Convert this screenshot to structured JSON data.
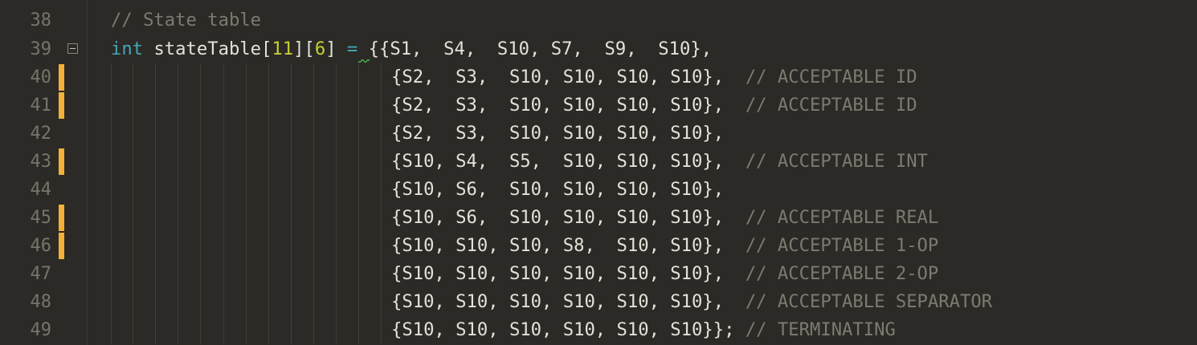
{
  "editor": {
    "lines": [
      {
        "number": "38",
        "code": "// State table",
        "type": "comment",
        "changed": false
      },
      {
        "number": "39",
        "type": "declaration",
        "changed": false,
        "keyword": "int",
        "identifier": "stateTable",
        "dim1_open": "[",
        "dim1": "11",
        "dim_mid": "][",
        "dim2": "6",
        "dim2_close": "]",
        "assign": "=",
        "rest": "{{S1,  S4,  S10, S7,  S9,  S10},"
      },
      {
        "number": "40",
        "code": "{S2,  S3,  S10, S10, S10, S10},  ",
        "comment": "// ACCEPTABLE ID",
        "changed": true
      },
      {
        "number": "41",
        "code": "{S2,  S3,  S10, S10, S10, S10},  ",
        "comment": "// ACCEPTABLE ID",
        "changed": true
      },
      {
        "number": "42",
        "code": "{S2,  S3,  S10, S10, S10, S10},",
        "comment": "",
        "changed": false
      },
      {
        "number": "43",
        "code": "{S10, S4,  S5,  S10, S10, S10},  ",
        "comment": "// ACCEPTABLE INT",
        "changed": true
      },
      {
        "number": "44",
        "code": "{S10, S6,  S10, S10, S10, S10},",
        "comment": "",
        "changed": false
      },
      {
        "number": "45",
        "code": "{S10, S6,  S10, S10, S10, S10},  ",
        "comment": "// ACCEPTABLE REAL",
        "changed": true
      },
      {
        "number": "46",
        "code": "{S10, S10, S10, S8,  S10, S10},  ",
        "comment": "// ACCEPTABLE 1-OP",
        "changed": true
      },
      {
        "number": "47",
        "code": "{S10, S10, S10, S10, S10, S10},  ",
        "comment": "// ACCEPTABLE 2-OP",
        "changed": false
      },
      {
        "number": "48",
        "code": "{S10, S10, S10, S10, S10, S10},  ",
        "comment": "// ACCEPTABLE SEPARATOR",
        "changed": false
      },
      {
        "number": "49",
        "code": "{S10, S10, S10, S10, S10, S10}}; ",
        "comment": "// TERMINATING",
        "changed": false
      }
    ],
    "fold_icon": "fold-collapse-icon",
    "colors": {
      "background": "#2b2a26",
      "keyword": "#45a6b6",
      "number": "#c6cf35",
      "comment": "#7d7b70",
      "text": "#e4e2d8",
      "line_number": "#77756b",
      "change_marker": "#f3b137"
    }
  }
}
